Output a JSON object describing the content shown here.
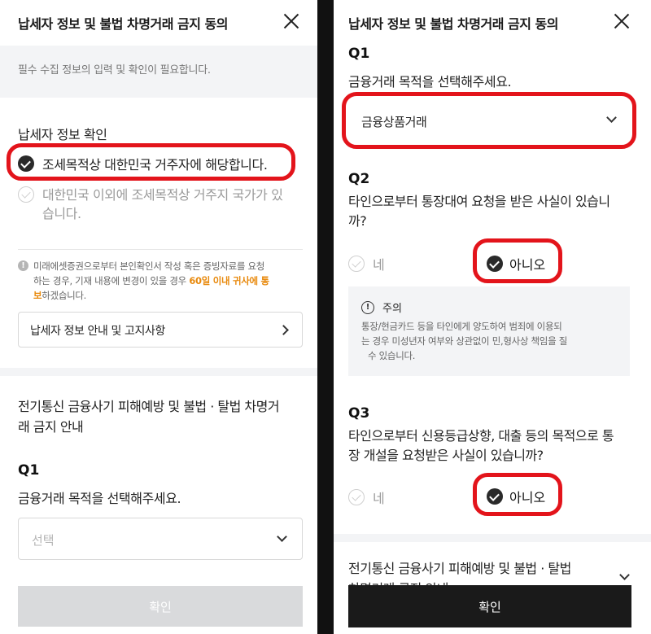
{
  "left": {
    "header_title": "납세자 정보 및 불법 차명거래 금지 동의",
    "notice": "필수 수집 정보의 입력 및 확인이 필요합니다.",
    "section_title": "납세자 정보 확인",
    "option1": "조세목적상 대한민국 거주자에 해당합니다.",
    "option2_line1": "대한민국 이외에 조세목적상 거주지 국가가 있",
    "option2_line2": "습니다.",
    "info_line1": "미래에셋증권으로부터 본인확인서 작성 혹은 증빙자료를 요청",
    "info_line2": "하는 경우, 기재 내용에 변경이 있을 경우 ",
    "info_highlight_a": "60일 이내 귀사에 통",
    "info_highlight_b": "보",
    "info_line3_tail": "하겠습니다.",
    "guide_button": "납세자 정보 안내 및 고지사항",
    "section2_line1": "전기통신 금융사기 피해예방 및 불법 · 탈법 차명거",
    "section2_line2": "래 금지 안내",
    "q1_label": "Q1",
    "q1_text": "금융거래 목적을 선택해주세요.",
    "q1_placeholder": "선택",
    "confirm_button": "확인"
  },
  "right": {
    "header_title": "납세자 정보 및 불법 차명거래 금지 동의",
    "q1_label": "Q1",
    "q1_text": "금융거래 목적을 선택해주세요.",
    "q1_selected": "금융상품거래",
    "q2_label": "Q2",
    "q2_line1": "타인으로부터 통장대여 요청을 받은 사실이 있습니",
    "q2_line2": "까?",
    "yes": "네",
    "no": "아니오",
    "caution_title": "주의",
    "caution_line1": "통장/현금카드 등을 타인에게 양도하여 범죄에 이용되",
    "caution_line2": "는 경우 미성년자 여부와 상관없이 민,형사상 책임을 질",
    "caution_line3": "수 있습니다.",
    "q3_label": "Q3",
    "q3_line1": "타인으로부터 신용등급상향, 대출 등의 목적으로 통",
    "q3_line2": "장 개설을 요청받은 사실이 있습니까?",
    "q3_yes": "네",
    "q3_no": "아니오",
    "footer_section_line1": "전기통신 금융사기 피해예방 및 불법 · 탈법",
    "footer_section_line2": "차명거래 금지 안내",
    "confirm_button": "확인"
  },
  "colors": {
    "accent_red": "#e3141b",
    "highlight_orange": "#e8890c",
    "confirm_disabled": "#d9dadc",
    "confirm_active": "#1a1a1a"
  }
}
